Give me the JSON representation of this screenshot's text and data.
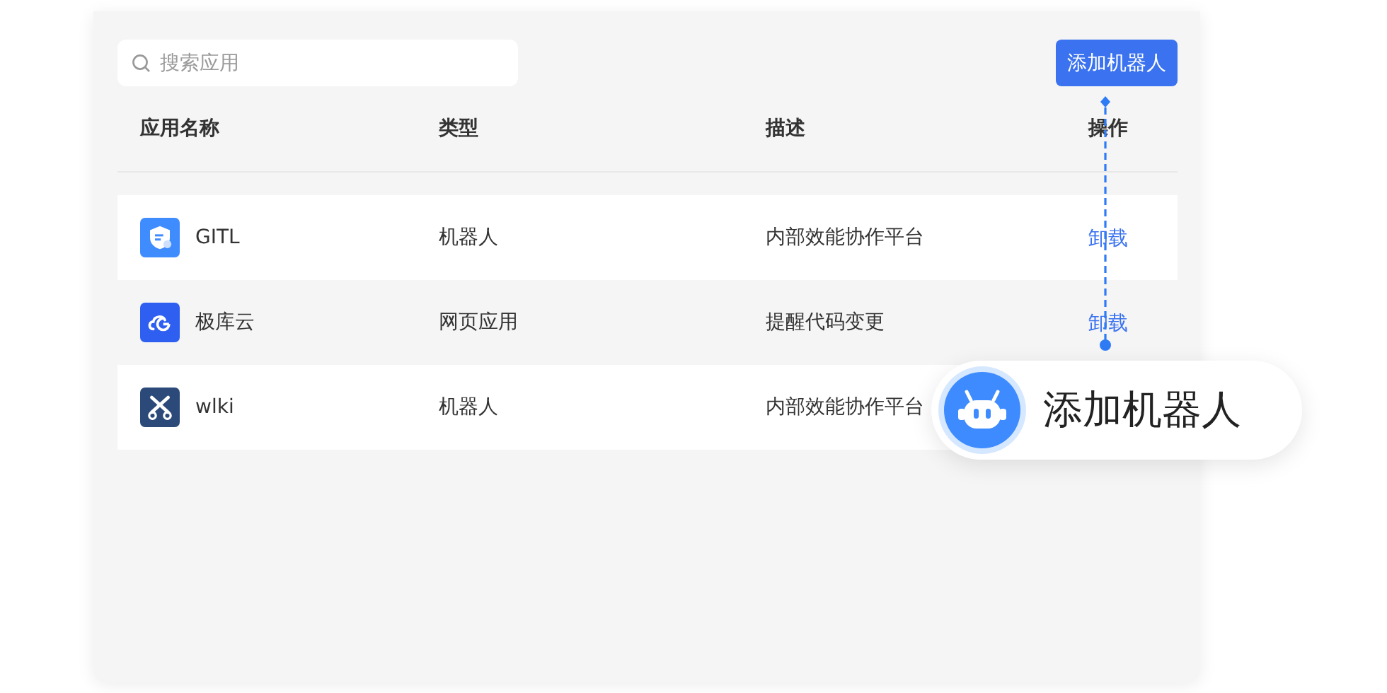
{
  "search": {
    "placeholder": "搜索应用"
  },
  "add_button": "添加机器人",
  "table": {
    "columns": [
      "应用名称",
      "类型",
      "描述",
      "操作"
    ],
    "rows": [
      {
        "name": "GITL",
        "type": "机器人",
        "description": "内部效能协作平台",
        "action": "卸载"
      },
      {
        "name": "极库云",
        "type": "网页应用",
        "description": "提醒代码变更",
        "action": "卸载"
      },
      {
        "name": "wlki",
        "type": "机器人",
        "description": "内部效能协作平台"
      }
    ]
  },
  "callout": {
    "label": "添加机器人"
  }
}
